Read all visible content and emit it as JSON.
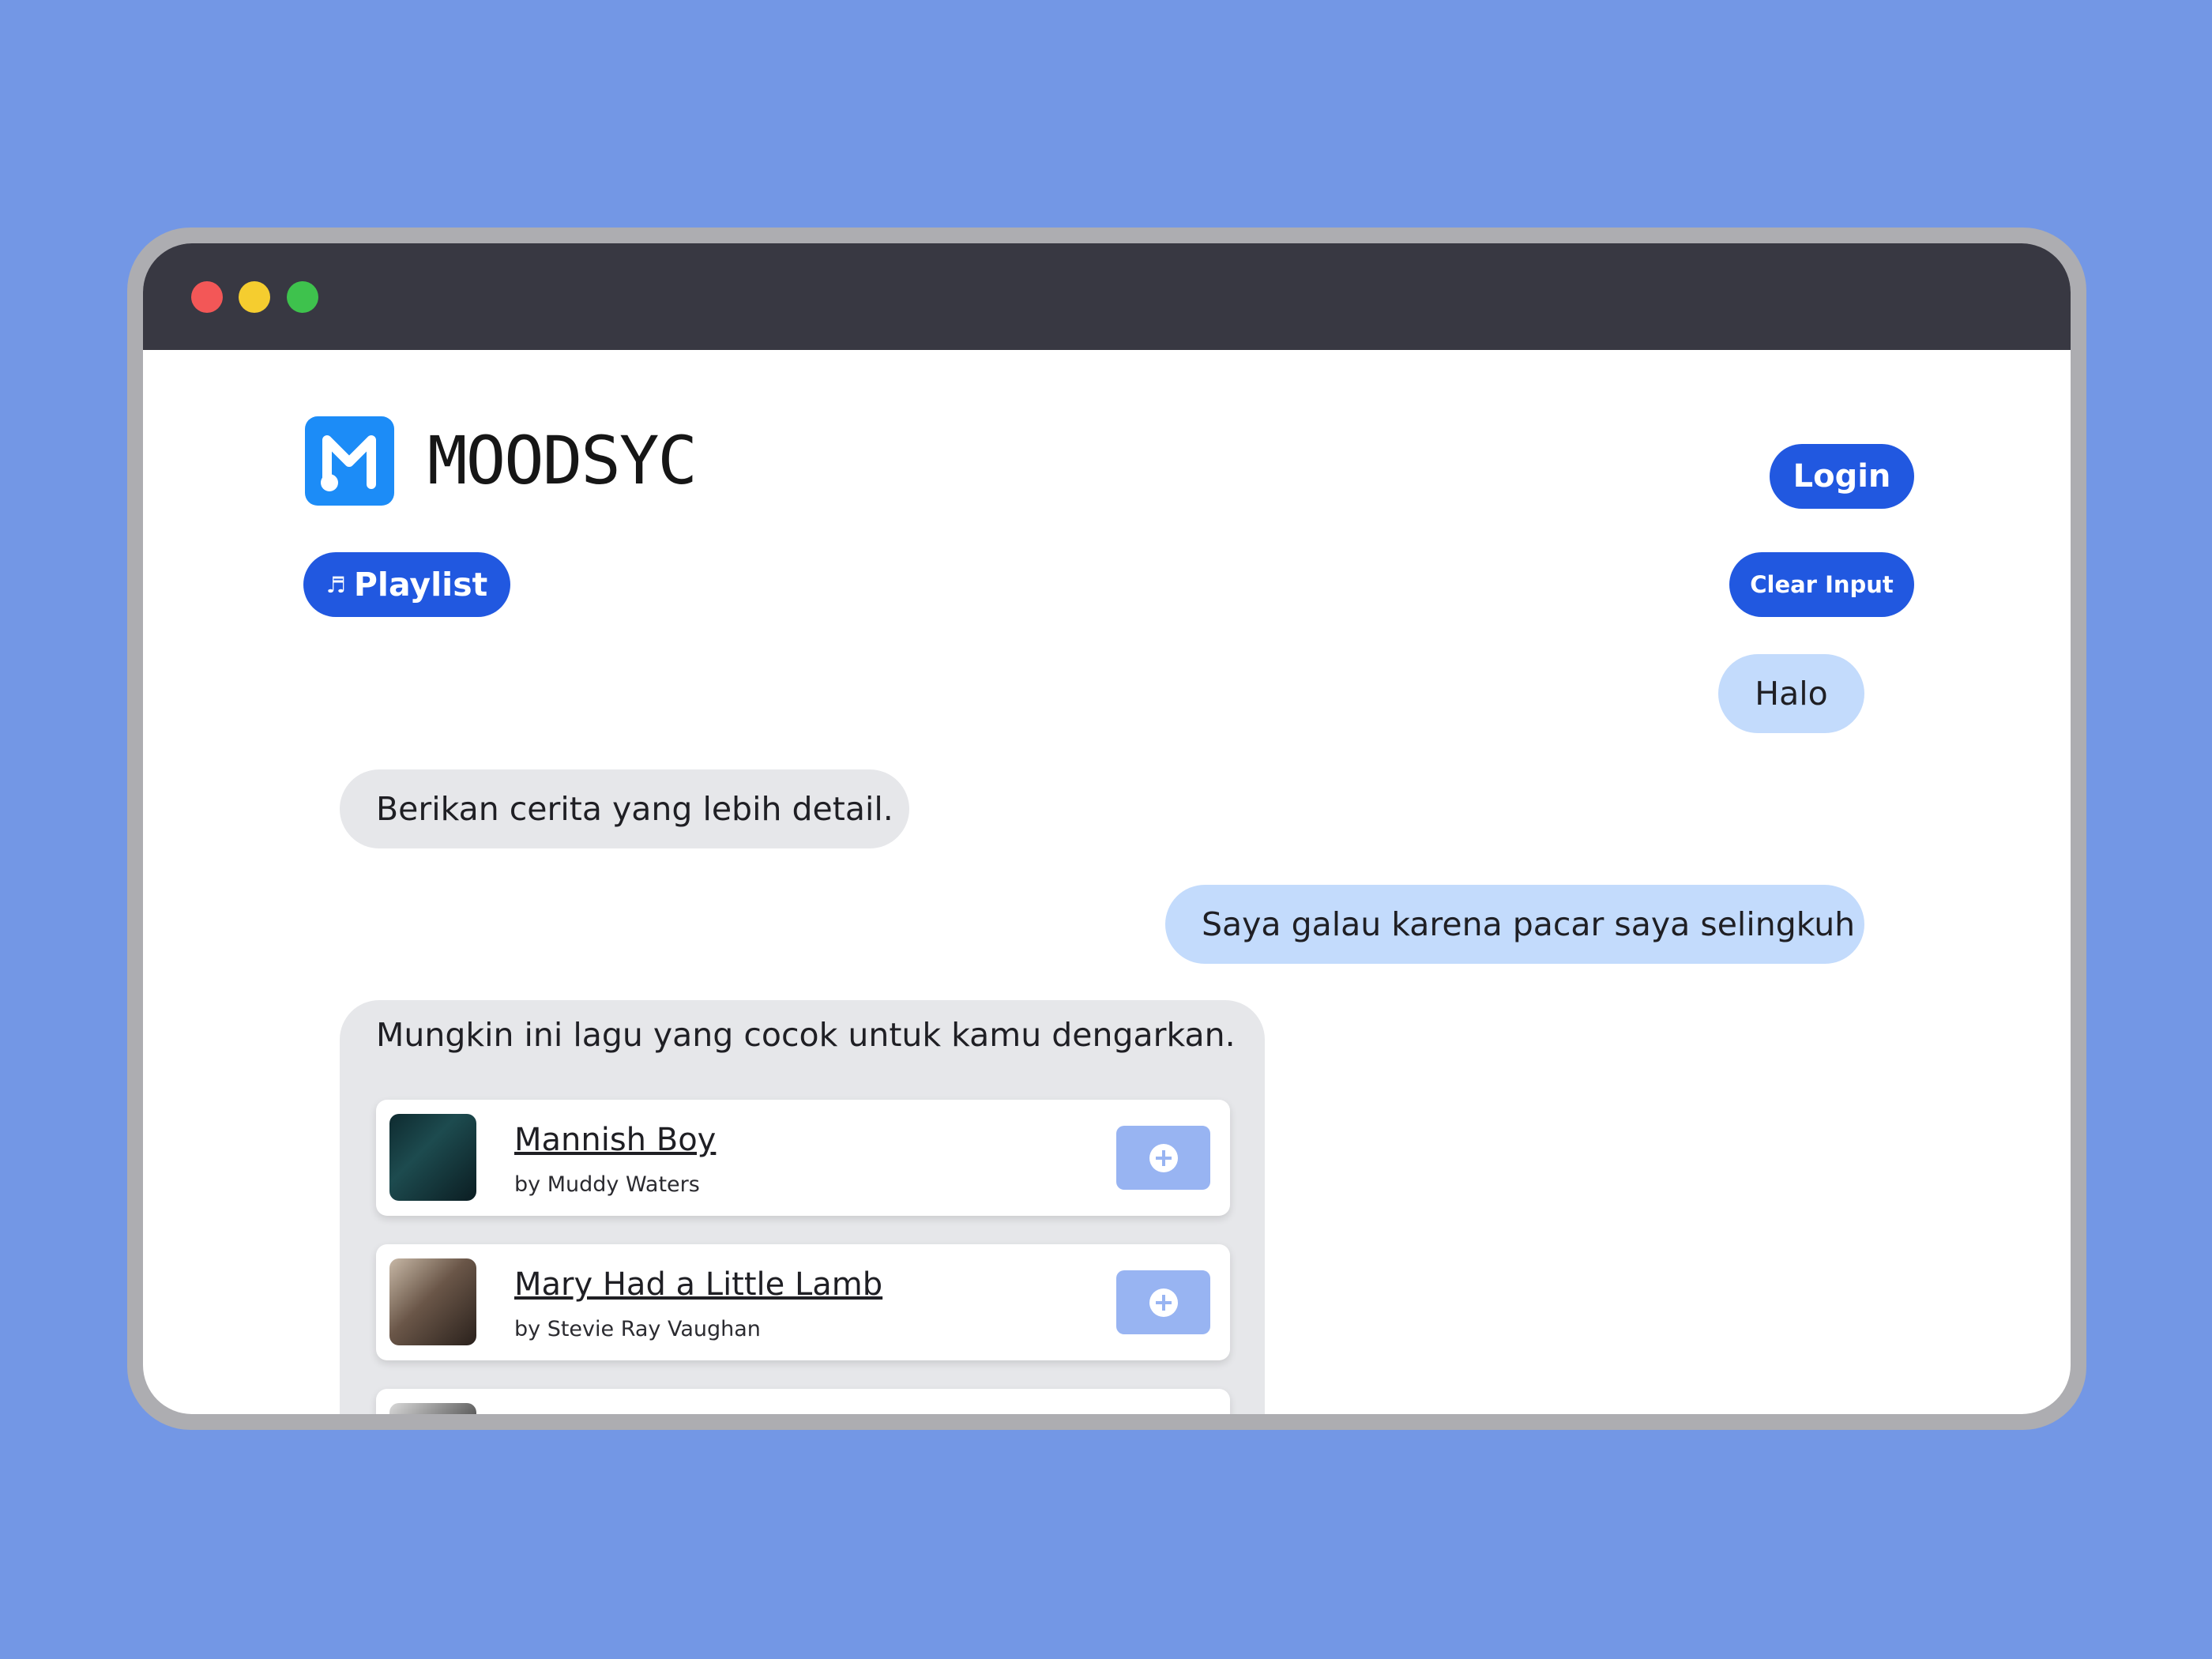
{
  "app": {
    "brand": "MOODSYC",
    "login_label": "Login",
    "playlist_label": "Playlist",
    "clear_label": "Clear Input"
  },
  "chat": {
    "messages": [
      {
        "role": "user",
        "text": "Halo"
      },
      {
        "role": "bot",
        "text": "Berikan cerita yang lebih detail."
      },
      {
        "role": "user",
        "text": "Saya galau karena pacar saya selingkuh"
      },
      {
        "role": "bot",
        "text": "Mungkin ini lagu yang cocok untuk kamu dengarkan."
      }
    ],
    "songs": [
      {
        "title": "Mannish Boy",
        "artist": "by Muddy Waters"
      },
      {
        "title": "Mary Had a Little Lamb",
        "artist": "by Stevie Ray Vaughan"
      },
      {
        "title": "",
        "artist": ""
      }
    ]
  },
  "icons": {
    "logo": "music-note-logo-icon",
    "playlist": "playlist-icon",
    "add": "plus-circle-icon"
  },
  "colors": {
    "background": "#7397e5",
    "titlebar": "#383842",
    "primary_button": "#2158e0",
    "user_bubble": "#c3dbfc",
    "bot_bubble": "#e6e7ea",
    "add_button": "#98b4f2",
    "logo": "#1c8cf7"
  }
}
